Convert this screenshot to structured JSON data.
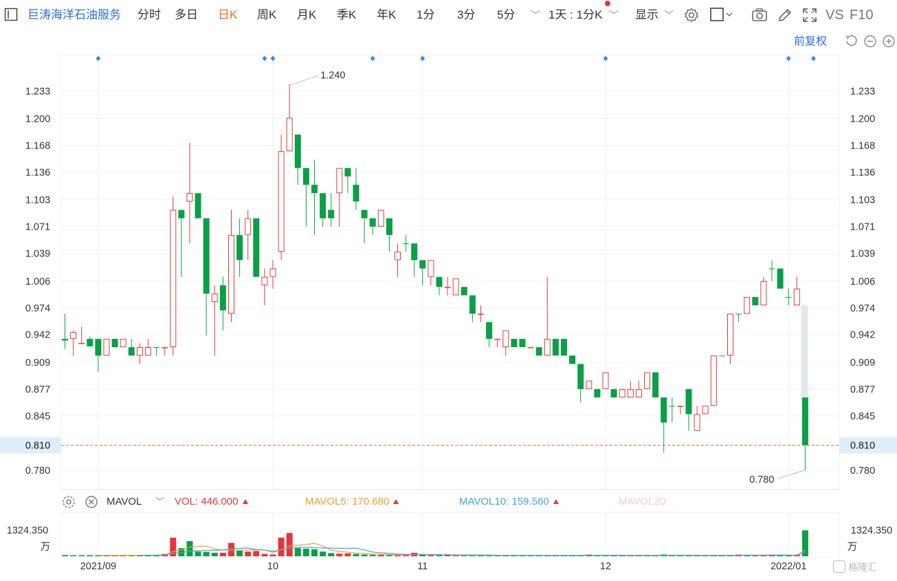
{
  "toolbar": {
    "stock_name": "巨涛海洋石油服务",
    "periods": [
      "分时",
      "多日",
      "日K",
      "周K",
      "月K",
      "季K",
      "年K",
      "1分",
      "3分",
      "5分"
    ],
    "active_period": "日K",
    "interval_select": "1天 : 1分K",
    "display_select": "显示",
    "vs_label": "VS",
    "f10_label": "F10"
  },
  "controls": {
    "adjust_label": "前复权"
  },
  "volume_legend": {
    "indicator": "MAVOL",
    "vol_label": "VOL:",
    "vol_value": "446.000",
    "mavol5_label": "MAVOL5:",
    "mavol5_value": "170.680",
    "mavol10_label": "MAVOL10:",
    "mavol10_value": "159.560",
    "mavol20_label": "MAVOL20:"
  },
  "colors": {
    "up": "#e6353a",
    "down": "#0aa045",
    "accent": "#f36c21",
    "mavol5": "#f39c32",
    "mavol10": "#3aa8d8",
    "mavol20": "#f2c9e0",
    "marker": "#3a8ee6"
  },
  "logo_text": "格隆汇",
  "chart_data": {
    "type": "candlestick",
    "ylim": [
      0.757,
      1.276
    ],
    "y_ticks": [
      "1.233",
      "1.200",
      "1.168",
      "1.136",
      "1.103",
      "1.071",
      "1.039",
      "1.006",
      "0.974",
      "0.942",
      "0.909",
      "0.877",
      "0.845",
      "0.810",
      "0.780"
    ],
    "x_labels": [
      {
        "index": 4,
        "label": "2021/09"
      },
      {
        "index": 25,
        "label": "10"
      },
      {
        "index": 43,
        "label": "11"
      },
      {
        "index": 65,
        "label": "12"
      },
      {
        "index": 87,
        "label": "2022/01"
      }
    ],
    "event_markers": [
      4,
      24,
      25,
      37,
      43,
      65,
      87,
      90
    ],
    "max_label": "1.240",
    "min_label": "0.780",
    "current_price": "0.810",
    "volume_max_label": "1324.350",
    "volume_unit": "万",
    "candles": [
      [
        0.937,
        0.935,
        0.967,
        0.925
      ],
      [
        0.937,
        0.945,
        0.947,
        0.917
      ],
      [
        0.932,
        0.932,
        0.952,
        0.932
      ],
      [
        0.937,
        0.928,
        0.94,
        0.928
      ],
      [
        0.937,
        0.917,
        0.937,
        0.897
      ],
      [
        0.917,
        0.937,
        0.937,
        0.917
      ],
      [
        0.937,
        0.927,
        0.937,
        0.927
      ],
      [
        0.927,
        0.937,
        0.937,
        0.927
      ],
      [
        0.927,
        0.917,
        0.937,
        0.917
      ],
      [
        0.917,
        0.927,
        0.932,
        0.907
      ],
      [
        0.917,
        0.927,
        0.937,
        0.917
      ],
      [
        0.927,
        0.927,
        0.927,
        0.917
      ],
      [
        0.927,
        0.927,
        0.927,
        0.917
      ],
      [
        0.927,
        1.091,
        1.107,
        0.917
      ],
      [
        1.091,
        1.081,
        1.091,
        1.011
      ],
      [
        1.101,
        1.111,
        1.171,
        1.051
      ],
      [
        1.111,
        1.081,
        1.111,
        1.081
      ],
      [
        1.081,
        0.991,
        1.081,
        0.941
      ],
      [
        0.981,
        0.991,
        1.001,
        0.917
      ],
      [
        1.001,
        0.971,
        1.011,
        0.947
      ],
      [
        0.967,
        1.061,
        1.091,
        0.957
      ],
      [
        1.061,
        1.031,
        1.081,
        1.011
      ],
      [
        1.061,
        1.081,
        1.091,
        1.031
      ],
      [
        1.081,
        1.011,
        1.081,
        1.011
      ],
      [
        1.001,
        1.011,
        1.021,
        0.977
      ],
      [
        1.011,
        1.021,
        1.031,
        0.997
      ],
      [
        1.041,
        1.161,
        1.181,
        1.031
      ],
      [
        1.161,
        1.201,
        1.241,
        1.161
      ],
      [
        1.181,
        1.141,
        1.181,
        1.121
      ],
      [
        1.141,
        1.121,
        1.141,
        1.071
      ],
      [
        1.121,
        1.111,
        1.151,
        1.061
      ],
      [
        1.111,
        1.081,
        1.111,
        1.071
      ],
      [
        1.091,
        1.081,
        1.111,
        1.071
      ],
      [
        1.111,
        1.141,
        1.141,
        1.071
      ],
      [
        1.141,
        1.131,
        1.141,
        1.111
      ],
      [
        1.121,
        1.101,
        1.141,
        1.091
      ],
      [
        1.091,
        1.081,
        1.091,
        1.051
      ],
      [
        1.081,
        1.071,
        1.081,
        1.061
      ],
      [
        1.071,
        1.091,
        1.091,
        1.071
      ],
      [
        1.081,
        1.061,
        1.081,
        1.041
      ],
      [
        1.031,
        1.041,
        1.051,
        1.011
      ],
      [
        1.051,
        1.051,
        1.061,
        1.041
      ],
      [
        1.051,
        1.031,
        1.051,
        1.011
      ],
      [
        1.031,
        1.021,
        1.031,
        1.001
      ],
      [
        1.011,
        1.031,
        1.031,
        1.001
      ],
      [
        1.011,
        0.999,
        1.011,
        0.989
      ],
      [
        0.999,
        0.999,
        1.011,
        0.989
      ],
      [
        0.989,
        1.009,
        1.009,
        0.989
      ],
      [
        0.999,
        0.989,
        0.999,
        0.989
      ],
      [
        0.989,
        0.967,
        0.989,
        0.957
      ],
      [
        0.967,
        0.967,
        0.977,
        0.957
      ],
      [
        0.957,
        0.937,
        0.957,
        0.927
      ],
      [
        0.937,
        0.937,
        0.937,
        0.927
      ],
      [
        0.927,
        0.947,
        0.947,
        0.917
      ],
      [
        0.937,
        0.927,
        0.937,
        0.927
      ],
      [
        0.937,
        0.927,
        0.937,
        0.927
      ],
      [
        0.927,
        0.927,
        0.927,
        0.927
      ],
      [
        0.927,
        0.917,
        0.927,
        0.917
      ],
      [
        0.917,
        0.937,
        1.011,
        0.917
      ],
      [
        0.937,
        0.917,
        0.937,
        0.917
      ],
      [
        0.937,
        0.917,
        0.937,
        0.917
      ],
      [
        0.917,
        0.907,
        0.917,
        0.907
      ],
      [
        0.907,
        0.877,
        0.907,
        0.861
      ],
      [
        0.877,
        0.887,
        0.887,
        0.877
      ],
      [
        0.877,
        0.867,
        0.877,
        0.867
      ],
      [
        0.877,
        0.897,
        0.897,
        0.877
      ],
      [
        0.877,
        0.867,
        0.877,
        0.867
      ],
      [
        0.867,
        0.877,
        0.877,
        0.867
      ],
      [
        0.867,
        0.877,
        0.887,
        0.867
      ],
      [
        0.867,
        0.877,
        0.887,
        0.867
      ],
      [
        0.877,
        0.897,
        0.897,
        0.877
      ],
      [
        0.897,
        0.867,
        0.897,
        0.867
      ],
      [
        0.867,
        0.837,
        0.867,
        0.801
      ],
      [
        0.857,
        0.857,
        0.867,
        0.837
      ],
      [
        0.857,
        0.857,
        0.857,
        0.847
      ],
      [
        0.877,
        0.847,
        0.877,
        0.827
      ],
      [
        0.827,
        0.847,
        0.857,
        0.827
      ],
      [
        0.847,
        0.857,
        0.857,
        0.847
      ],
      [
        0.857,
        0.917,
        0.917,
        0.857
      ],
      [
        0.917,
        0.917,
        0.917,
        0.917
      ],
      [
        0.917,
        0.967,
        0.967,
        0.907
      ],
      [
        0.967,
        0.967,
        0.967,
        0.957
      ],
      [
        0.967,
        0.987,
        0.987,
        0.967
      ],
      [
        0.987,
        0.977,
        0.987,
        0.977
      ],
      [
        0.977,
        1.006,
        1.011,
        0.977
      ],
      [
        1.021,
        1.021,
        1.031,
        1.006
      ],
      [
        1.021,
        0.997,
        1.021,
        0.997
      ],
      [
        0.987,
        0.987,
        0.997,
        0.977
      ],
      [
        0.977,
        0.997,
        1.011,
        0.977
      ],
      [
        0.867,
        0.81,
        0.867,
        0.78
      ]
    ],
    "volumes": [
      [
        20,
        0
      ],
      [
        15,
        0
      ],
      [
        15,
        0
      ],
      [
        15,
        0
      ],
      [
        15,
        0
      ],
      [
        15,
        1
      ],
      [
        15,
        0
      ],
      [
        15,
        1
      ],
      [
        20,
        0
      ],
      [
        20,
        1
      ],
      [
        20,
        0
      ],
      [
        20,
        0
      ],
      [
        40,
        1
      ],
      [
        320,
        1
      ],
      [
        140,
        0
      ],
      [
        260,
        0
      ],
      [
        80,
        0
      ],
      [
        75,
        0
      ],
      [
        60,
        0
      ],
      [
        60,
        1
      ],
      [
        230,
        1
      ],
      [
        95,
        0
      ],
      [
        80,
        1
      ],
      [
        90,
        1
      ],
      [
        40,
        1
      ],
      [
        30,
        1
      ],
      [
        320,
        1
      ],
      [
        400,
        1
      ],
      [
        140,
        0
      ],
      [
        130,
        0
      ],
      [
        120,
        0
      ],
      [
        80,
        0
      ],
      [
        55,
        0
      ],
      [
        45,
        1
      ],
      [
        50,
        1
      ],
      [
        40,
        0
      ],
      [
        30,
        0
      ],
      [
        25,
        0
      ],
      [
        25,
        1
      ],
      [
        20,
        0
      ],
      [
        20,
        1
      ],
      [
        25,
        1
      ],
      [
        60,
        1
      ],
      [
        25,
        0
      ],
      [
        20,
        1
      ],
      [
        15,
        0
      ],
      [
        15,
        1
      ],
      [
        15,
        1
      ],
      [
        15,
        0
      ],
      [
        15,
        0
      ],
      [
        20,
        0
      ],
      [
        15,
        0
      ],
      [
        15,
        0
      ],
      [
        15,
        1
      ],
      [
        15,
        0
      ],
      [
        15,
        0
      ],
      [
        15,
        0
      ],
      [
        15,
        0
      ],
      [
        15,
        1
      ],
      [
        15,
        0
      ],
      [
        15,
        0
      ],
      [
        15,
        0
      ],
      [
        15,
        0
      ],
      [
        30,
        1
      ],
      [
        15,
        0
      ],
      [
        15,
        0
      ],
      [
        15,
        1
      ],
      [
        15,
        0
      ],
      [
        15,
        1
      ],
      [
        15,
        1
      ],
      [
        15,
        0
      ],
      [
        15,
        1
      ],
      [
        30,
        0
      ],
      [
        15,
        1
      ],
      [
        15,
        0
      ],
      [
        15,
        0
      ],
      [
        15,
        1
      ],
      [
        15,
        0
      ],
      [
        15,
        1
      ],
      [
        15,
        0
      ],
      [
        15,
        1
      ],
      [
        30,
        1
      ],
      [
        20,
        0
      ],
      [
        15,
        1
      ],
      [
        20,
        1
      ],
      [
        25,
        1
      ],
      [
        20,
        0
      ],
      [
        20,
        0
      ],
      [
        20,
        1
      ],
      [
        446,
        0
      ]
    ],
    "mavol5": [],
    "mavol10": []
  }
}
